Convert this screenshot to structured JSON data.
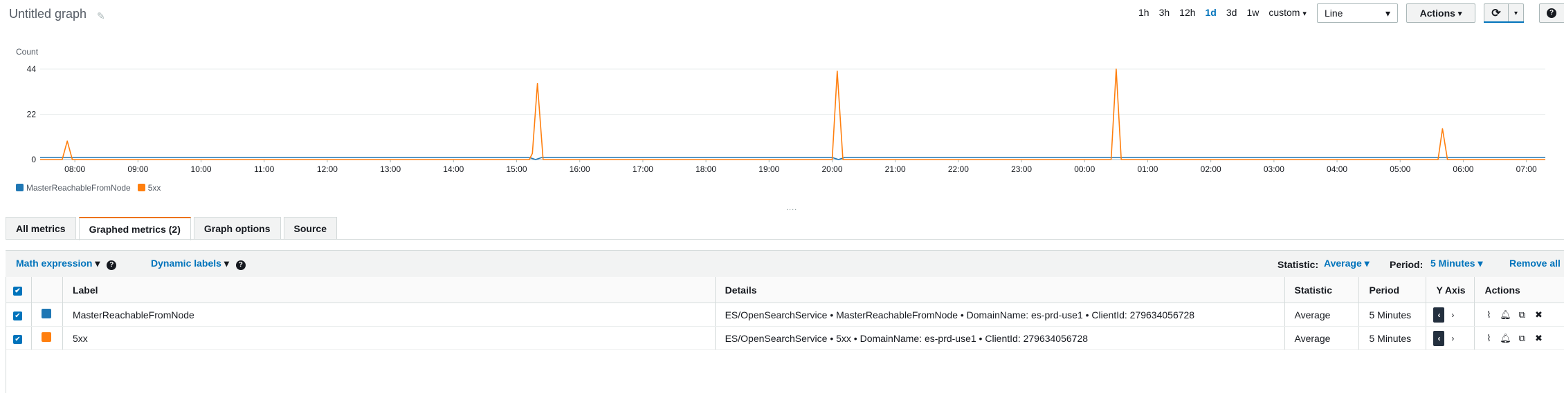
{
  "header": {
    "title": "Untitled graph",
    "time_ranges": [
      "1h",
      "3h",
      "12h",
      "1d",
      "3d",
      "1w",
      "custom"
    ],
    "selected_range": "1d",
    "custom_caret": "▾",
    "graph_type": "Line",
    "actions_label": "Actions",
    "help_label": "?"
  },
  "chart_data": {
    "type": "line",
    "ylabel": "Count",
    "y_ticks": [
      0,
      22,
      44
    ],
    "ylim": [
      0,
      44
    ],
    "x_ticks": [
      "08:00",
      "09:00",
      "10:00",
      "11:00",
      "12:00",
      "13:00",
      "14:00",
      "15:00",
      "16:00",
      "17:00",
      "18:00",
      "19:00",
      "20:00",
      "21:00",
      "22:00",
      "23:00",
      "00:00",
      "01:00",
      "02:00",
      "03:00",
      "04:00",
      "05:00",
      "06:00",
      "07:00"
    ],
    "x_start_hour": 7.45,
    "x_end_hour": 31.3,
    "series": [
      {
        "name": "MasterReachableFromNode",
        "color": "#1f77b4",
        "points": [
          [
            7.45,
            1
          ],
          [
            15.2,
            1
          ],
          [
            15.3,
            0
          ],
          [
            15.4,
            1
          ],
          [
            20.0,
            1
          ],
          [
            20.1,
            0
          ],
          [
            20.2,
            1
          ],
          [
            31.3,
            1
          ]
        ]
      },
      {
        "name": "5xx",
        "color": "#ff7f0e",
        "points": [
          [
            7.45,
            0
          ],
          [
            7.8,
            0
          ],
          [
            7.88,
            9
          ],
          [
            7.96,
            0
          ],
          [
            15.2,
            0
          ],
          [
            15.25,
            3
          ],
          [
            15.33,
            37
          ],
          [
            15.42,
            0
          ],
          [
            20.0,
            0
          ],
          [
            20.08,
            43
          ],
          [
            20.17,
            0
          ],
          [
            24.42,
            0
          ],
          [
            24.5,
            44
          ],
          [
            24.58,
            0
          ],
          [
            29.6,
            0
          ],
          [
            29.67,
            15
          ],
          [
            29.75,
            0
          ],
          [
            31.3,
            0
          ]
        ]
      }
    ]
  },
  "legend": [
    {
      "name": "MasterReachableFromNode",
      "color": "#1f77b4"
    },
    {
      "name": "5xx",
      "color": "#ff7f0e"
    }
  ],
  "drag_handle": "....",
  "tabs": [
    "All metrics",
    "Graphed metrics (2)",
    "Graph options",
    "Source"
  ],
  "active_tab": "Graphed metrics (2)",
  "toolbar": {
    "math_expression": "Math expression",
    "dynamic_labels": "Dynamic labels",
    "statistic_label": "Statistic:",
    "statistic_value": "Average",
    "period_label": "Period:",
    "period_value": "5 Minutes",
    "remove_all": "Remove all"
  },
  "table": {
    "columns": [
      "Label",
      "Details",
      "Statistic",
      "Period",
      "Y Axis",
      "Actions"
    ],
    "rows": [
      {
        "label": "MasterReachableFromNode",
        "color": "#1f77b4",
        "details": "ES/OpenSearchService • MasterReachableFromNode • DomainName: es-prd-use1 • ClientId: 279634056728",
        "statistic": "Average",
        "period": "5 Minutes"
      },
      {
        "label": "5xx",
        "color": "#ff7f0e",
        "details": "ES/OpenSearchService • 5xx • DomainName: es-prd-use1 • ClientId: 279634056728",
        "statistic": "Average",
        "period": "5 Minutes"
      }
    ]
  },
  "icons": {
    "check": "✔",
    "caret": "▾",
    "refresh": "⟳",
    "pencil": "✎",
    "left": "‹",
    "right": "›",
    "chart-line": "⌇",
    "bell": "🔔",
    "copy": "⧉",
    "remove": "✖"
  }
}
